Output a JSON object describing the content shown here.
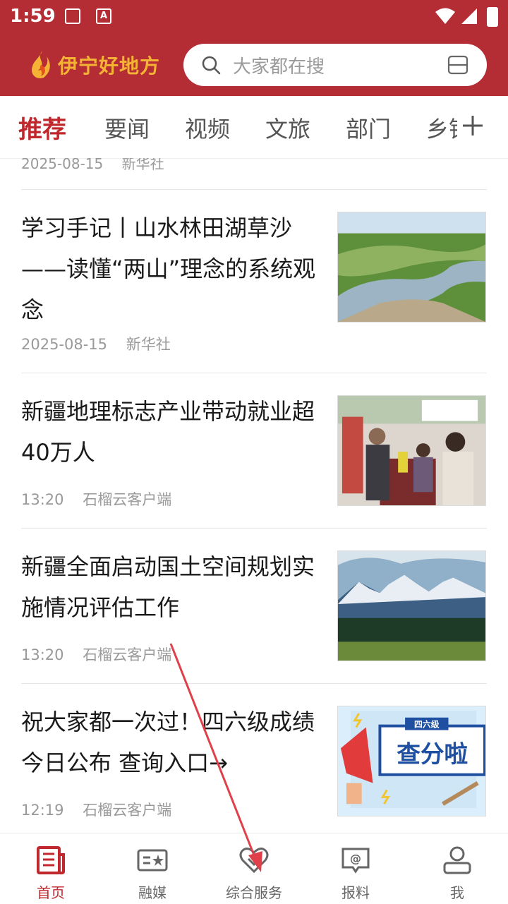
{
  "status": {
    "time": "1:59"
  },
  "header": {
    "logo_text": "伊宁好地方",
    "search_placeholder": "大家都在搜"
  },
  "tabs": [
    {
      "label": "推荐",
      "active": true
    },
    {
      "label": "要闻"
    },
    {
      "label": "视频"
    },
    {
      "label": "文旅"
    },
    {
      "label": "部门"
    },
    {
      "label": "乡镇"
    }
  ],
  "feed": {
    "partial": {
      "date": "2025-08-15",
      "source": "新华社"
    },
    "items": [
      {
        "title": "学习手记丨山水林田湖草沙——读懂“两山”理念的系统观念",
        "date": "2025-08-15",
        "source": "新华社",
        "image": "river-grassland"
      },
      {
        "title": "新疆地理标志产业带动就业超40万人",
        "date": "13:20",
        "source": "石榴云客户端",
        "image": "exhibition-people"
      },
      {
        "title": "新疆全面启动国土空间规划实施情况评估工作",
        "date": "13:20",
        "source": "石榴云客户端",
        "image": "snow-mountain-forest"
      },
      {
        "title": "祝大家都一次过！四六级成绩今日公布 查询入口→",
        "date": "12:19",
        "source": "石榴云客户端",
        "image": "cet-score-poster",
        "image_text": {
          "badge": "四六级",
          "headline": "查分啦"
        }
      }
    ]
  },
  "bottom_nav": [
    {
      "label": "首页",
      "icon": "news-icon",
      "active": true
    },
    {
      "label": "融媒",
      "icon": "media-icon"
    },
    {
      "label": "综合服务",
      "icon": "service-heart-icon"
    },
    {
      "label": "报料",
      "icon": "report-icon"
    },
    {
      "label": "我",
      "icon": "profile-icon"
    }
  ],
  "colors": {
    "brand_red": "#B52D34",
    "active_red": "#C0282E",
    "logo_gold": "#F5B335"
  }
}
